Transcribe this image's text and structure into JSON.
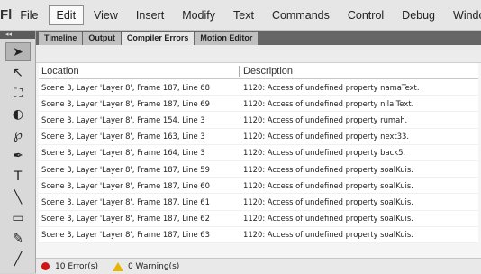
{
  "app": {
    "logo": "Fl"
  },
  "menu": [
    "File",
    "Edit",
    "View",
    "Insert",
    "Modify",
    "Text",
    "Commands",
    "Control",
    "Debug",
    "Window"
  ],
  "menu_active": "Edit",
  "toolbar": {
    "collapse": "◂◂",
    "tools": [
      {
        "icon": "selection-arrow-icon",
        "glyph": "➤"
      },
      {
        "icon": "subselection-icon",
        "glyph": "↖"
      },
      {
        "icon": "free-transform-icon",
        "glyph": "⛶"
      },
      {
        "icon": "3d-rotation-icon",
        "glyph": "◐"
      },
      {
        "icon": "lasso-icon",
        "glyph": "℘"
      },
      {
        "icon": "pen-icon",
        "glyph": "✒"
      },
      {
        "icon": "text-tool-icon",
        "glyph": "T"
      },
      {
        "icon": "line-tool-icon",
        "glyph": "╲"
      },
      {
        "icon": "rectangle-tool-icon",
        "glyph": "▭"
      },
      {
        "icon": "pencil-icon",
        "glyph": "✎"
      },
      {
        "icon": "brush-icon",
        "glyph": "╱"
      }
    ]
  },
  "panel": {
    "tabs": [
      "Timeline",
      "Output",
      "Compiler Errors",
      "Motion Editor"
    ],
    "active_tab": "Compiler Errors",
    "columns": [
      "Location",
      "Description"
    ],
    "rows": [
      {
        "location": "Scene 3, Layer 'Layer 8', Frame 187, Line 68",
        "description": "1120: Access of undefined property namaText."
      },
      {
        "location": "Scene 3, Layer 'Layer 8', Frame 187, Line 69",
        "description": "1120: Access of undefined property nilaiText."
      },
      {
        "location": "Scene 3, Layer 'Layer 8', Frame 154, Line 3",
        "description": "1120: Access of undefined property rumah."
      },
      {
        "location": "Scene 3, Layer 'Layer 8', Frame 163, Line 3",
        "description": "1120: Access of undefined property next33."
      },
      {
        "location": "Scene 3, Layer 'Layer 8', Frame 164, Line 3",
        "description": "1120: Access of undefined property back5."
      },
      {
        "location": "Scene 3, Layer 'Layer 8', Frame 187, Line 59",
        "description": "1120: Access of undefined property soalKuis."
      },
      {
        "location": "Scene 3, Layer 'Layer 8', Frame 187, Line 60",
        "description": "1120: Access of undefined property soalKuis."
      },
      {
        "location": "Scene 3, Layer 'Layer 8', Frame 187, Line 61",
        "description": "1120: Access of undefined property soalKuis."
      },
      {
        "location": "Scene 3, Layer 'Layer 8', Frame 187, Line 62",
        "description": "1120: Access of undefined property soalKuis."
      },
      {
        "location": "Scene 3, Layer 'Layer 8', Frame 187, Line 63",
        "description": "1120: Access of undefined property soalKuis."
      }
    ],
    "status": {
      "errors": "10 Error(s)",
      "warnings": "0 Warning(s)"
    }
  }
}
